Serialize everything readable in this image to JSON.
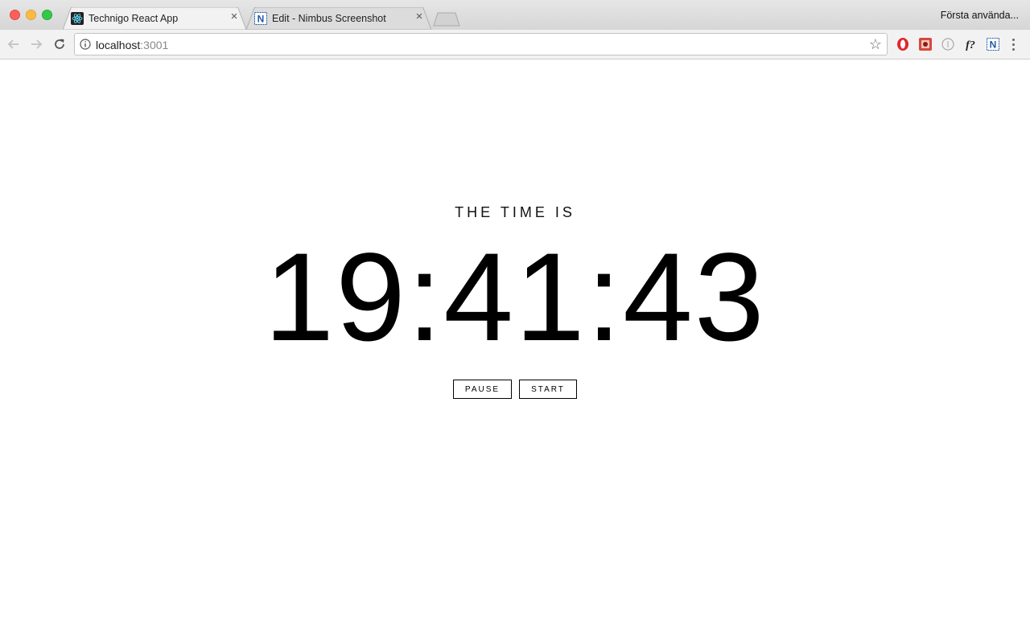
{
  "browser": {
    "tabs": [
      {
        "title": "Technigo React App",
        "active": true
      },
      {
        "title": "Edit - Nimbus Screenshot",
        "active": false
      }
    ],
    "profile_name": "Första använda...",
    "address": {
      "host": "localhost",
      "port": ":3001"
    },
    "icons": [
      "back-icon",
      "forward-icon",
      "reload-icon",
      "info-icon",
      "star-icon",
      "opera-icon",
      "extension-icon",
      "circle-extension-icon",
      "fonts-extension-icon",
      "nimbus-icon",
      "menu-icon"
    ]
  },
  "page": {
    "label": "THE TIME IS",
    "time": "19:41:43",
    "buttons": {
      "pause": "PAUSE",
      "start": "START"
    }
  },
  "colors": {
    "background": "#ffffff",
    "text": "#000000",
    "border": "#000000"
  }
}
